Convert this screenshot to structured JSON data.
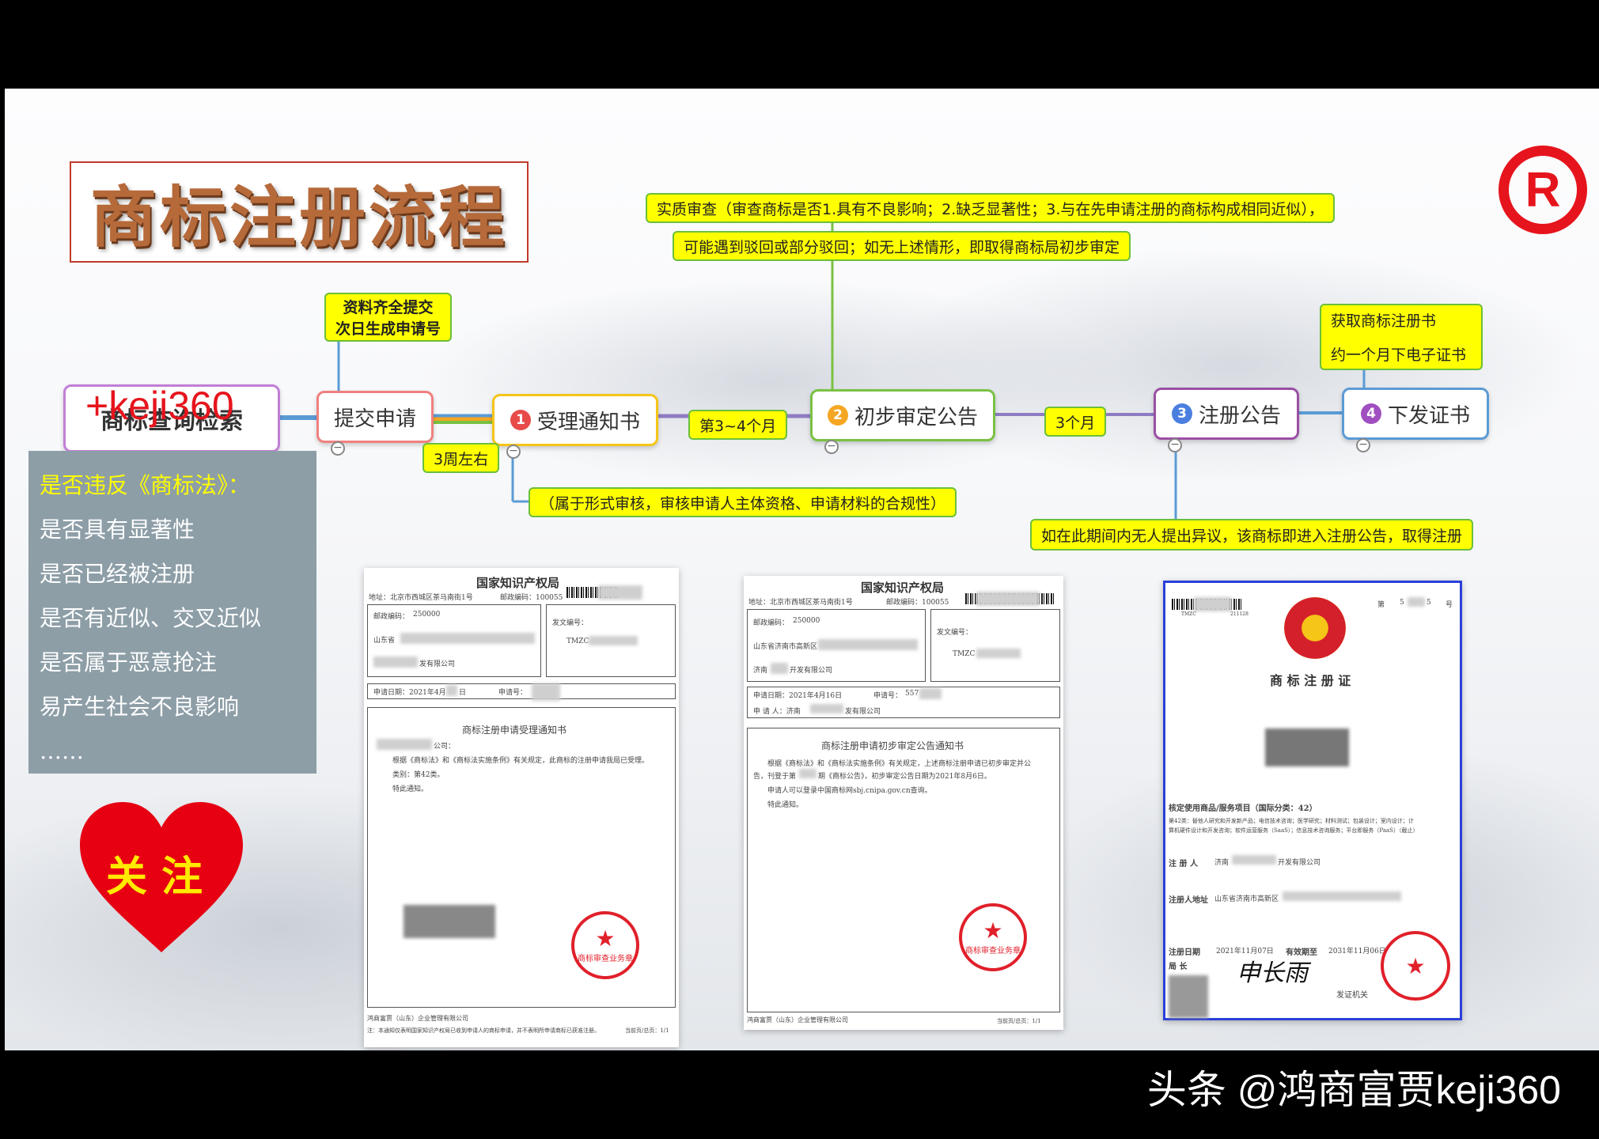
{
  "title": "商标注册流程",
  "reg_symbol": "R",
  "contact": "+keji360",
  "flow": {
    "start": "商标查询检索",
    "submit": "提交申请",
    "step1": {
      "num": "1",
      "label": "受理通知书"
    },
    "step2": {
      "num": "2",
      "label": "初步审定公告"
    },
    "step3": {
      "num": "3",
      "label": "注册公告"
    },
    "step4": {
      "num": "4",
      "label": "下发证书"
    }
  },
  "notes": {
    "submit_note_1": "资料齐全提交",
    "submit_note_2": "次日生成申请号",
    "three_weeks": "3周左右",
    "formal_review": "（属于形式审核，审核申请人主体资格、申请材料的合规性）",
    "months_3_4": "第3~4个月",
    "substantive_1": "实质审查（审查商标是否1.具有不良影响；2.缺乏显著性；3.与在先申请注册的商标构成相同近似），",
    "substantive_2": "可能遇到驳回或部分驳回；如无上述情形，即取得商标局初步审定",
    "months_3": "3个月",
    "opposition": "如在此期间内无人提出异议，该商标即进入注册公告，取得注册",
    "cert_1": "获取商标注册书",
    "cert_2": "约一个月下电子证书"
  },
  "law_box": {
    "lines": [
      "是否违反《商标法》：",
      "是否具有显著性",
      "是否已经被注册",
      "是否有近似、交叉近似",
      "是否属于恶意抢注",
      "易产生社会不良影响",
      "……"
    ]
  },
  "heart": "关注",
  "doc1": {
    "org": "国家知识产权局",
    "addr": "地址：北京市西城区茶马南街1号",
    "zip": "邮政编码：100055",
    "postcode": "邮政编码：",
    "postcode_val": "250000",
    "recipient_prov": "山东省",
    "recipient_co_tail": "发有限公司",
    "send_no_label": "发文编号：",
    "send_no": "TMZC",
    "apply_date": "申请日期：2021年4月",
    "apply_date_tail": "日",
    "apply_no": "申请号：",
    "doc_title": "商标注册申请受理通知书",
    "co_line": "公司：",
    "body_1": "根据《商标法》和《商标法实施条例》有关规定，此商标的注册申请我局已受理。",
    "body_2": "类别：第42类。",
    "body_3": "特此通知。",
    "footer_1": "鸿商富贾（山东）企业管理有限公司",
    "footer_2": "注：本通知仅表明国家知识产权局已收到申请人的商标申请，并不表明所申请商标已获准注册。",
    "page": "当前页/总页：1/1",
    "stamp": "商标审查业务章"
  },
  "doc2": {
    "org": "国家知识产权局",
    "addr": "地址：北京市西城区茶马南街1号",
    "zip": "邮政编码：100055",
    "postcode": "邮政编码：",
    "postcode_val": "250000",
    "recipient_prov": "山东省济南市高新区",
    "recipient_co": "济南",
    "recipient_co_tail": "开发有限公司",
    "send_no_label": "发文编号：",
    "send_no": "TMZC",
    "apply_date": "申请日期：2021年4月16日",
    "apply_no": "申请号：",
    "apply_no_val": "557",
    "applicant": "申 请 人：济南",
    "applicant_tail": "发有限公司",
    "doc_title": "商标注册申请初步审定公告通知书",
    "body_1": "根据《商标法》和《商标法实施条例》有关规定，上述商标注册申请已初步审定并公",
    "body_2": "告，刊登于第",
    "body_2_tail": "期《商标公告》，初步审定公告日期为2021年8月6日。",
    "body_3": "申请人可以登录中国商标网sbj.cnipa.gov.cn查询。",
    "body_4": "特此通知。",
    "footer_1": "鸿商富贾（山东）企业管理有限公司",
    "page": "当前页/总页：1/1",
    "stamp": "商标审查业务章"
  },
  "doc3": {
    "no_label": "第",
    "no_tail": "号",
    "no_val": "5",
    "no_val_tail": "5",
    "tmzc": "TMZC",
    "tmzc_tail": "211128",
    "title": "商 标 注 册 证",
    "goods_label": "核定使用商品/服务项目（国际分类：42）",
    "goods_text_1": "第42类：替他人研究和开发新产品；电信技术咨询；医学研究；材料测试；包装设计；室内设计；计",
    "goods_text_2": "算机硬件设计和开发咨询；软件运营服务（SaaS）；信息技术咨询服务；平台即服务（PaaS）（截止）",
    "registrant_label": "注 册 人",
    "registrant": "济南",
    "registrant_tail": "开发有限公司",
    "address_label": "注册人地址",
    "address": "山东省济南市高新区",
    "reg_date_label": "注册日期",
    "reg_date": "2021年11月07日",
    "valid_label": "有效期至",
    "valid": "2031年11月06日",
    "director_label": "局 长",
    "signature": "申长雨",
    "issuer": "发证机关"
  },
  "watermark": "头条 @鸿商富贾keji360"
}
